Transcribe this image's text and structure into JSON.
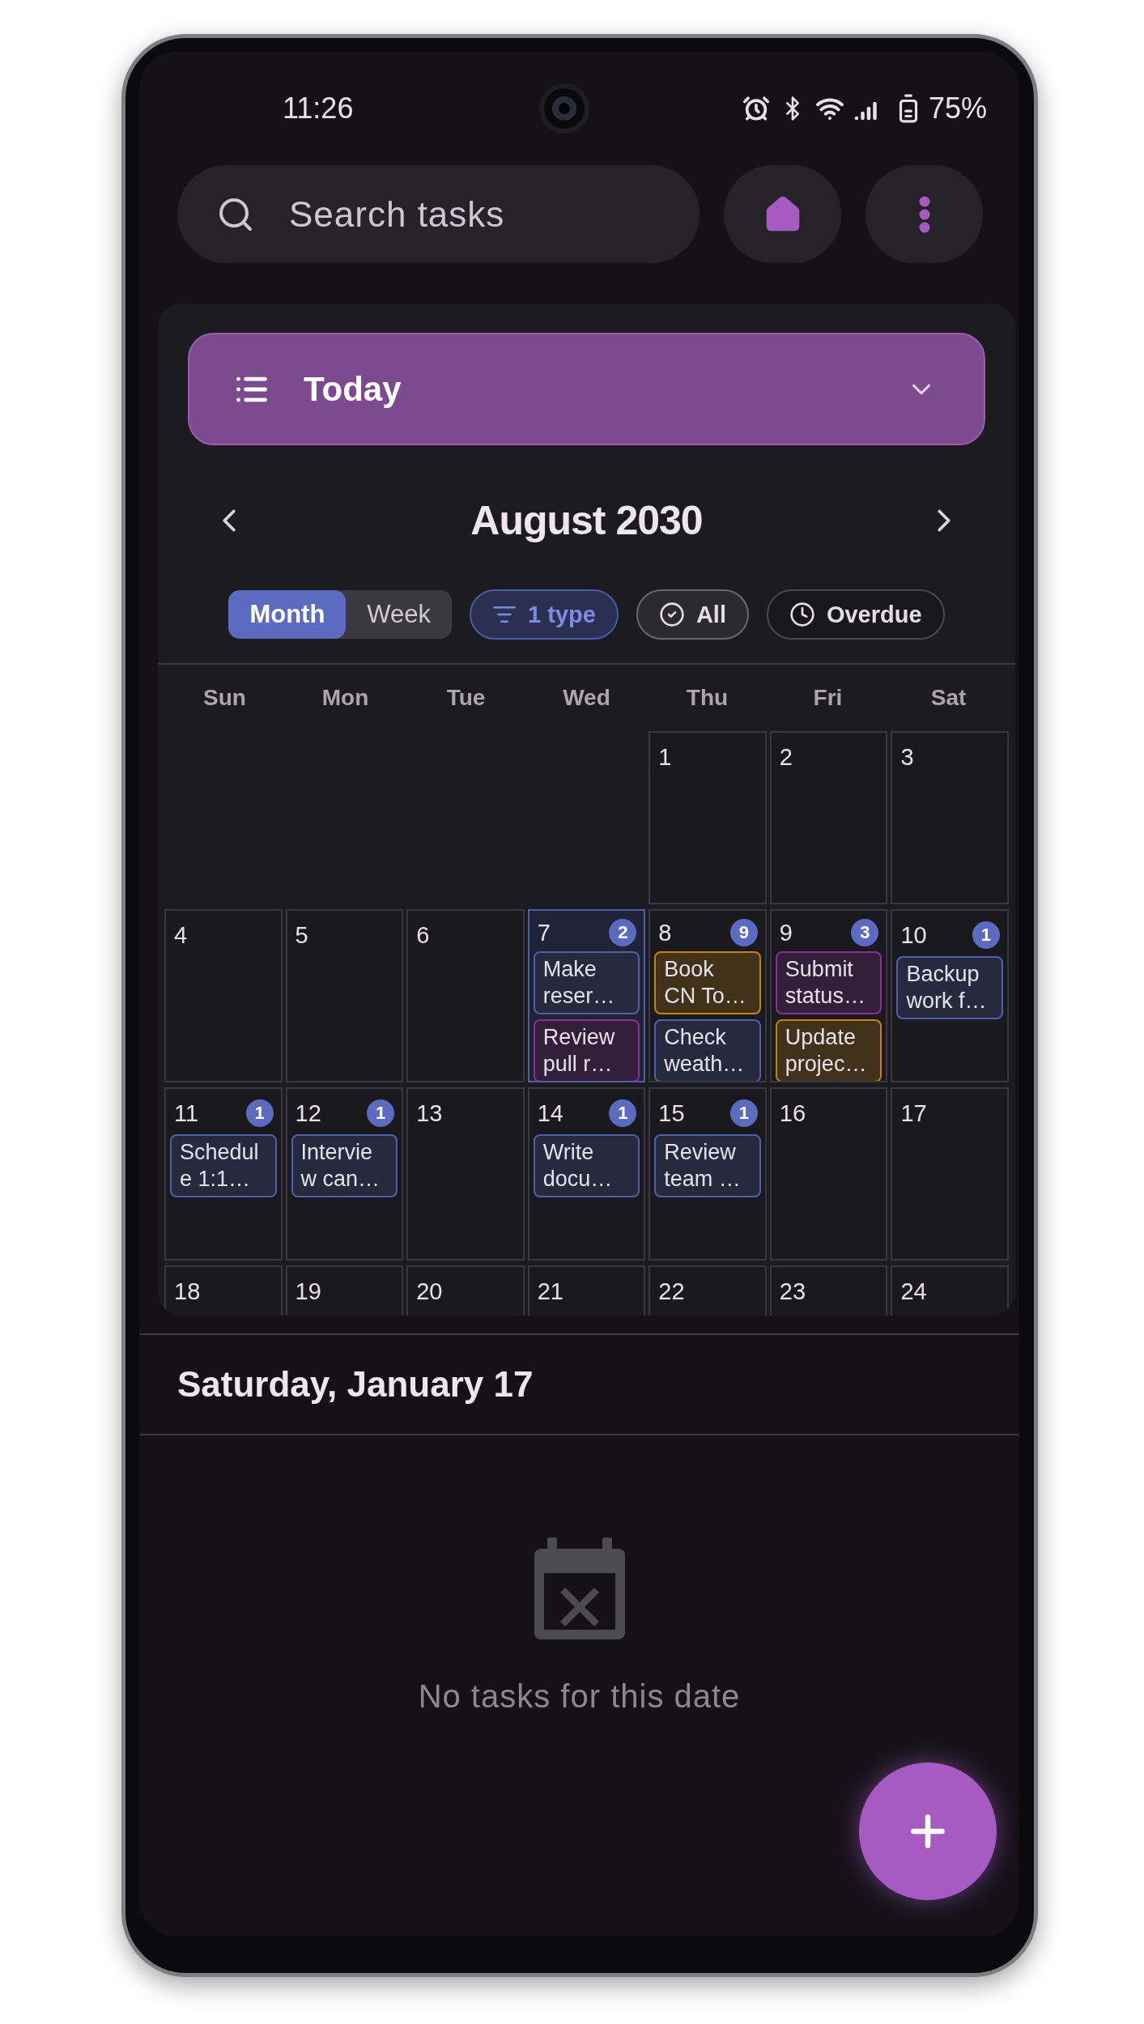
{
  "status_bar": {
    "time": "11:26",
    "battery": "75%"
  },
  "search": {
    "placeholder": "Search tasks"
  },
  "view_selector": {
    "label": "Today"
  },
  "calendar": {
    "title": "August 2030",
    "view_modes": [
      {
        "label": "Month",
        "selected": true
      },
      {
        "label": "Week",
        "selected": false
      }
    ],
    "filters": [
      {
        "kind": "type",
        "label": "1 type",
        "active": true
      },
      {
        "kind": "status",
        "label": "All",
        "active": true
      },
      {
        "kind": "overdue",
        "label": "Overdue",
        "active": false
      }
    ],
    "weekdays": [
      "Sun",
      "Mon",
      "Tue",
      "Wed",
      "Thu",
      "Fri",
      "Sat"
    ],
    "weeks": [
      {
        "days": [
          {
            "kind": "blank"
          },
          {
            "kind": "blank"
          },
          {
            "kind": "blank"
          },
          {
            "kind": "blank"
          },
          {
            "kind": "day",
            "number": "1",
            "today": false
          },
          {
            "kind": "day",
            "number": "2",
            "today": false
          },
          {
            "kind": "day",
            "number": "3",
            "today": false
          }
        ]
      },
      {
        "days": [
          {
            "kind": "day",
            "number": "4",
            "today": false
          },
          {
            "kind": "day",
            "number": "5",
            "today": false
          },
          {
            "kind": "day",
            "number": "6",
            "today": false
          },
          {
            "kind": "day",
            "number": "7",
            "today": true,
            "count": "2",
            "tasks": [
              {
                "title": "Make reser…",
                "color": "#4f5fa8"
              },
              {
                "title": "Review pull r…",
                "color": "#8a2f9a"
              }
            ]
          },
          {
            "kind": "day",
            "number": "8",
            "today": false,
            "count": "9",
            "tasks": [
              {
                "title": "Book CN To…",
                "color": "#c7820e"
              },
              {
                "title": "Check weath…",
                "color": "#4f5fa8"
              }
            ]
          },
          {
            "kind": "day",
            "number": "9",
            "today": false,
            "count": "3",
            "tasks": [
              {
                "title": "Submit status…",
                "color": "#8a2f9a"
              },
              {
                "title": "Update projec…",
                "color": "#c7820e"
              }
            ]
          },
          {
            "kind": "day",
            "number": "10",
            "today": false,
            "count": "1",
            "tasks": [
              {
                "title": "Backup work f…",
                "color": "#4f5fa8"
              }
            ]
          }
        ]
      },
      {
        "days": [
          {
            "kind": "day",
            "number": "11",
            "today": false,
            "count": "1",
            "tasks": [
              {
                "title": "Schedule 1:1…",
                "color": "#4f5fa8"
              }
            ]
          },
          {
            "kind": "day",
            "number": "12",
            "today": false,
            "count": "1",
            "tasks": [
              {
                "title": "Interview can…",
                "color": "#4f5fa8"
              }
            ]
          },
          {
            "kind": "day",
            "number": "13",
            "today": false
          },
          {
            "kind": "day",
            "number": "14",
            "today": false,
            "count": "1",
            "tasks": [
              {
                "title": "Write docu…",
                "color": "#4f5fa8"
              }
            ]
          },
          {
            "kind": "day",
            "number": "15",
            "today": false,
            "count": "1",
            "tasks": [
              {
                "title": "Review team …",
                "color": "#4f5fa8"
              }
            ]
          },
          {
            "kind": "day",
            "number": "16",
            "today": false
          },
          {
            "kind": "day",
            "number": "17",
            "today": false
          }
        ]
      },
      {
        "days": [
          {
            "kind": "day",
            "number": "18",
            "today": false
          },
          {
            "kind": "day",
            "number": "19",
            "today": false
          },
          {
            "kind": "day",
            "number": "20",
            "today": false
          },
          {
            "kind": "day",
            "number": "21",
            "today": false
          },
          {
            "kind": "day",
            "number": "22",
            "today": false
          },
          {
            "kind": "day",
            "number": "23",
            "today": false
          },
          {
            "kind": "day",
            "number": "24",
            "today": false
          }
        ]
      }
    ]
  },
  "selected_date": {
    "title": "Saturday, January 17"
  },
  "empty_state": {
    "message": "No tasks for this date"
  }
}
